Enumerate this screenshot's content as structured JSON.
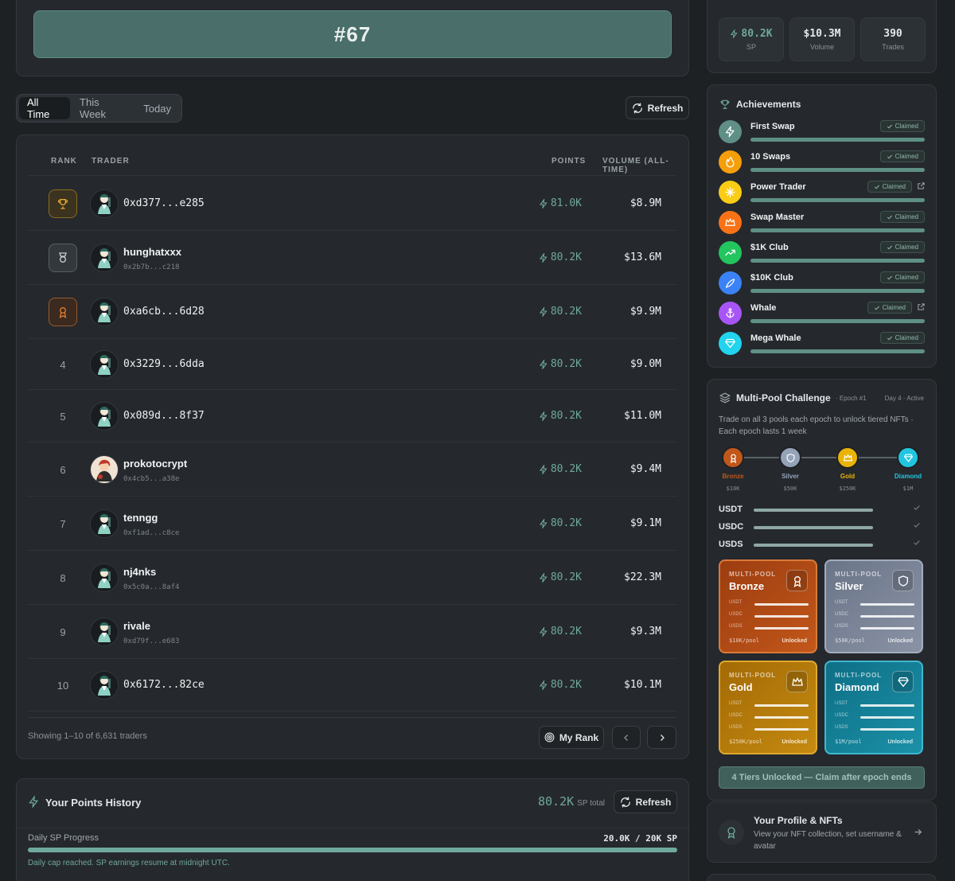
{
  "rank_banner": {
    "rank": "#67"
  },
  "tabs": [
    {
      "label": "All Time",
      "active": true
    },
    {
      "label": "This Week",
      "active": false
    },
    {
      "label": "Today",
      "active": false
    }
  ],
  "toolbar": {
    "refresh_label": "Refresh"
  },
  "leaderboard": {
    "headers": {
      "rank": "RANK",
      "trader": "TRADER",
      "points": "POINTS",
      "volume": "VOLUME (ALL-TIME)"
    },
    "rows": [
      {
        "rank": "",
        "badge": "gold",
        "name": "0xd377...e285",
        "sub": "",
        "points": "81.0K",
        "volume": "$8.9M"
      },
      {
        "rank": "",
        "badge": "silver",
        "name": "hunghatxxx",
        "sub": "0x2b7b...c218",
        "points": "80.2K",
        "volume": "$13.6M"
      },
      {
        "rank": "",
        "badge": "bronze",
        "name": "0xa6cb...6d28",
        "sub": "",
        "points": "80.2K",
        "volume": "$9.9M"
      },
      {
        "rank": "4",
        "badge": "",
        "name": "0x3229...6dda",
        "sub": "",
        "points": "80.2K",
        "volume": "$9.0M"
      },
      {
        "rank": "5",
        "badge": "",
        "name": "0x089d...8f37",
        "sub": "",
        "points": "80.2K",
        "volume": "$11.0M"
      },
      {
        "rank": "6",
        "badge": "",
        "name": "prokotocrypt",
        "sub": "0x4cb5...a38e",
        "points": "80.2K",
        "volume": "$9.4M"
      },
      {
        "rank": "7",
        "badge": "",
        "name": "tenngg",
        "sub": "0xf1ad...c8ce",
        "points": "80.2K",
        "volume": "$9.1M"
      },
      {
        "rank": "8",
        "badge": "",
        "name": "nj4nks",
        "sub": "0x5c0a...8af4",
        "points": "80.2K",
        "volume": "$22.3M"
      },
      {
        "rank": "9",
        "badge": "",
        "name": "rivale",
        "sub": "0xd79f...e683",
        "points": "80.2K",
        "volume": "$9.3M"
      },
      {
        "rank": "10",
        "badge": "",
        "name": "0x6172...82ce",
        "sub": "",
        "points": "80.2K",
        "volume": "$10.1M"
      }
    ],
    "showing": "Showing 1–10 of 6,631 traders",
    "my_rank_label": "My Rank"
  },
  "points_history": {
    "title": "Your Points History",
    "total": "80.2K",
    "total_suffix": "SP total",
    "refresh_label": "Refresh",
    "progress_label": "Daily SP Progress",
    "progress_value": "20.0K / 20K SP",
    "progress_fraction": 1.0,
    "note": "Daily cap reached. SP earnings resume at midnight UTC."
  },
  "stats": [
    {
      "value": "80.2K",
      "label": "SP",
      "icon": "bolt-icon"
    },
    {
      "value": "$10.3M",
      "label": "Volume"
    },
    {
      "value": "390",
      "label": "Trades"
    }
  ],
  "achievements": {
    "title": "Achievements",
    "claimed_label": "Claimed",
    "items": [
      {
        "name": "First Swap",
        "color": "#5f8f86",
        "icon": "bolt-icon",
        "external": false
      },
      {
        "name": "10 Swaps",
        "color": "#f59e0b",
        "icon": "flame-icon",
        "external": false
      },
      {
        "name": "Power Trader",
        "color": "#facc15",
        "icon": "sparkle-icon",
        "external": true
      },
      {
        "name": "Swap Master",
        "color": "#f97316",
        "icon": "crown-icon",
        "external": false
      },
      {
        "name": "$1K Club",
        "color": "#22c55e",
        "icon": "trend-up-icon",
        "external": false
      },
      {
        "name": "$10K Club",
        "color": "#3b82f6",
        "icon": "rocket-icon",
        "external": false
      },
      {
        "name": "Whale",
        "color": "#a855f7",
        "icon": "anchor-icon",
        "external": true
      },
      {
        "name": "Mega Whale",
        "color": "#22d3ee",
        "icon": "diamond-icon",
        "external": false
      }
    ]
  },
  "multipool": {
    "title": "Multi-Pool Challenge",
    "epoch": "· Epoch #1",
    "status": "Day 4 · Active",
    "description": "Trade on all 3 pools each epoch to unlock tiered NFTs · Each epoch lasts 1 week",
    "tiers": [
      {
        "name": "Bronze",
        "amount": "$10K",
        "color": "#c2571a"
      },
      {
        "name": "Silver",
        "amount": "$50K",
        "color": "#94a3b8"
      },
      {
        "name": "Gold",
        "amount": "$250K",
        "color": "#eab308"
      },
      {
        "name": "Diamond",
        "amount": "$1M",
        "color": "#22c5e0"
      }
    ],
    "pools": [
      "USDT",
      "USDC",
      "USDS"
    ],
    "nfts": [
      {
        "kicker": "MULTI-POOL",
        "name": "Bronze",
        "amount": "$10K/pool",
        "status": "Unlocked"
      },
      {
        "kicker": "MULTI-POOL",
        "name": "Silver",
        "amount": "$50K/pool",
        "status": "Unlocked"
      },
      {
        "kicker": "MULTI-POOL",
        "name": "Gold",
        "amount": "$250K/pool",
        "status": "Unlocked"
      },
      {
        "kicker": "MULTI-POOL",
        "name": "Diamond",
        "amount": "$1M/pool",
        "status": "Unlocked"
      }
    ],
    "footer": "4 Tiers Unlocked — Claim after epoch ends"
  },
  "profile": {
    "title": "Your Profile & NFTs",
    "description": "View your NFT collection, set username & avatar"
  }
}
